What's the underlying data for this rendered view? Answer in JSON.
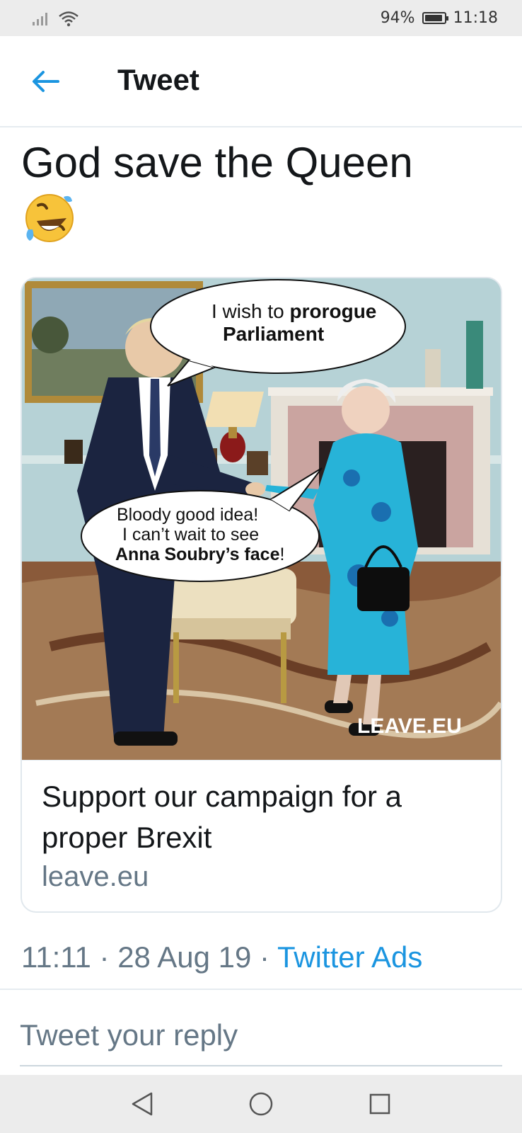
{
  "status_bar": {
    "battery": "94%",
    "time": "11:18",
    "battery_level": 0.94
  },
  "header": {
    "title": "Tweet"
  },
  "tweet": {
    "text": "God save the Queen",
    "emoji_name": "rolling-on-floor-laughing-emoji",
    "card": {
      "bubble_top_line1_a": "I wish to ",
      "bubble_top_line1_b": "prorogue",
      "bubble_top_line2": "Parliament",
      "bubble_bottom_line1": "Bloody good idea!",
      "bubble_bottom_line2": "I can’t wait to see",
      "bubble_bottom_line3_a": "Anna Soubry’s face",
      "bubble_bottom_line3_b": "!",
      "watermark": "LEAVE.EU",
      "title": "Support our campaign for a proper Brexit",
      "domain": "leave.eu"
    },
    "meta": {
      "time": "11:11",
      "sep1": " · ",
      "date": "28 Aug 19",
      "sep2": " · ",
      "source": "Twitter Ads"
    }
  },
  "reply": {
    "placeholder": "Tweet your reply"
  },
  "nav": {
    "back": "back-triangle-icon",
    "home": "home-circle-icon",
    "recents": "recents-square-icon"
  },
  "colors": {
    "accent": "#1b95e0",
    "muted": "#657786",
    "text": "#14171a",
    "divider": "#e6ecf0"
  }
}
